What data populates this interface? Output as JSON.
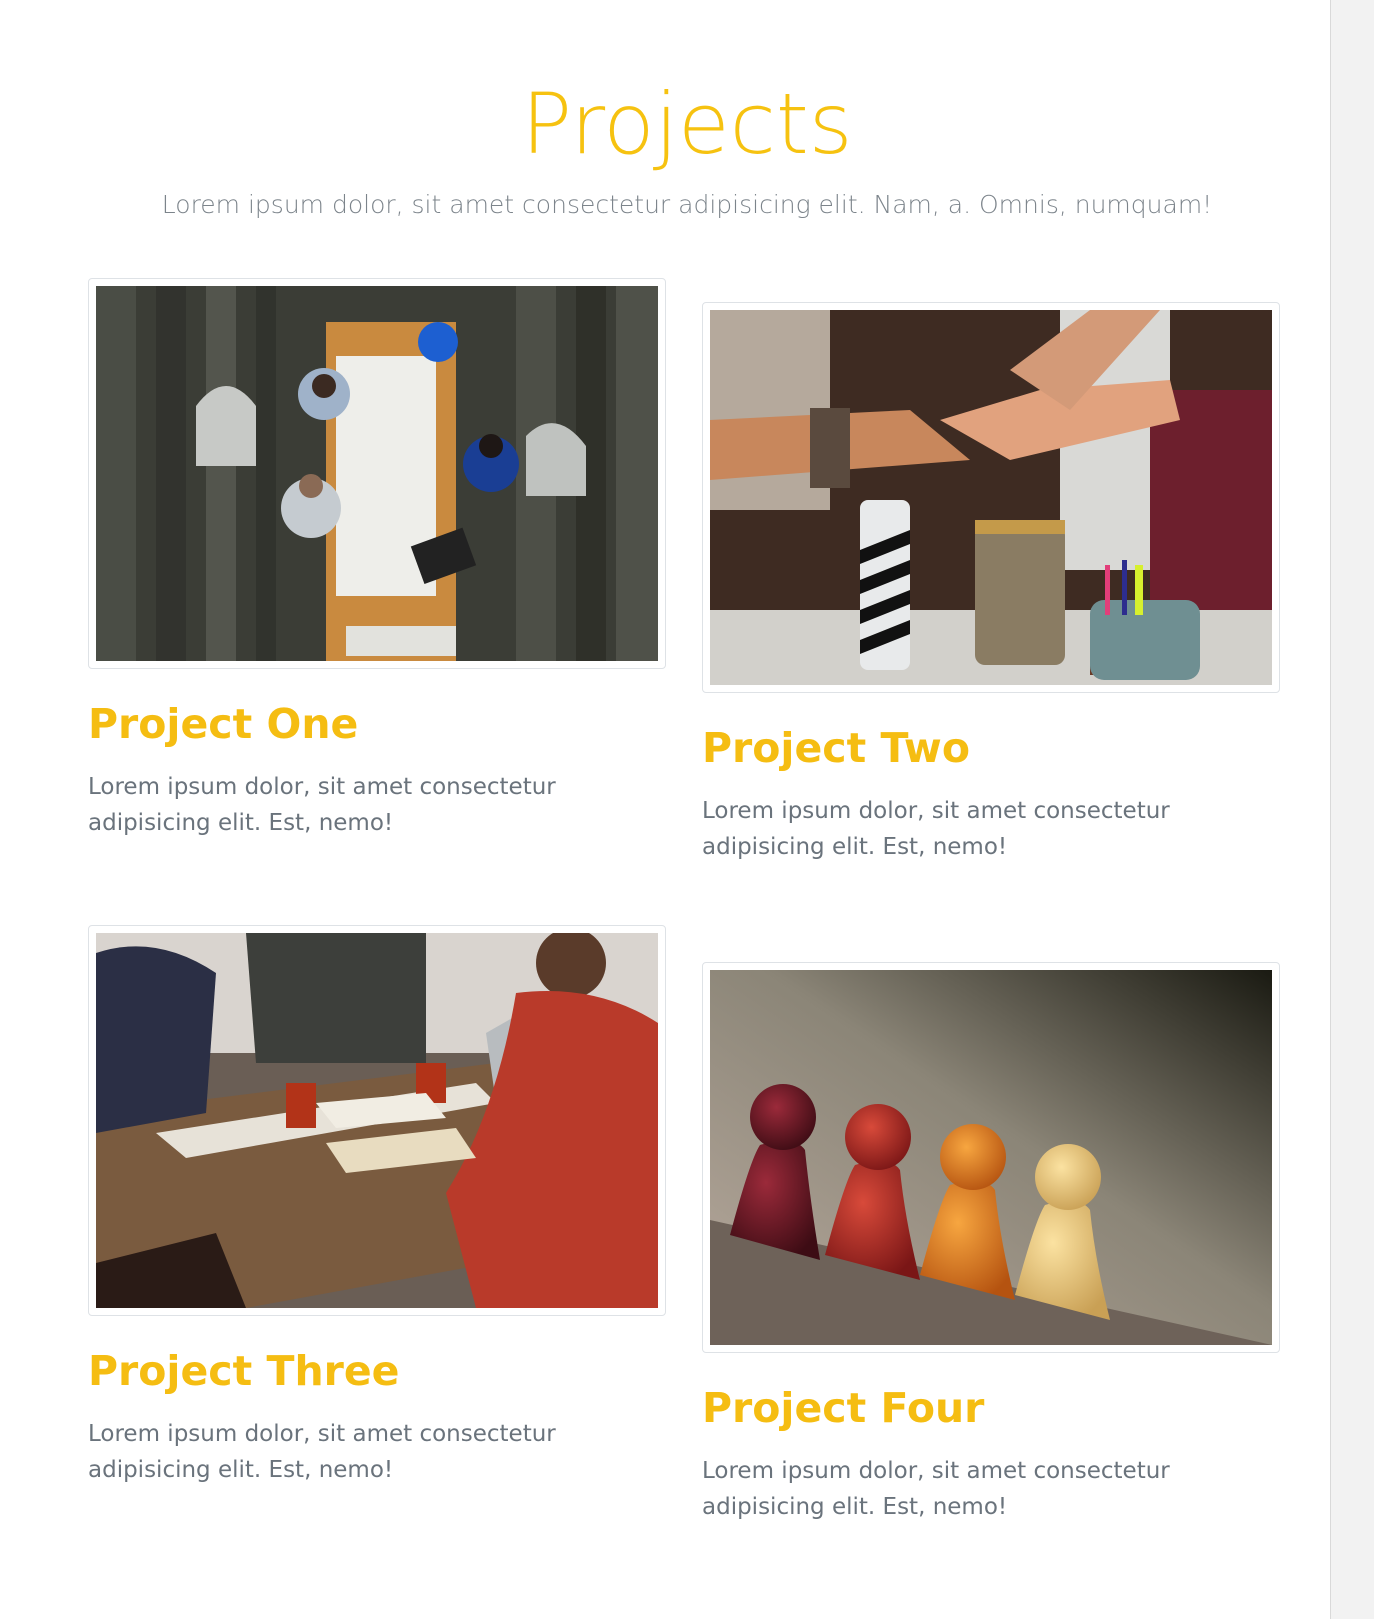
{
  "section": {
    "title": "Projects",
    "subtitle": "Lorem ipsum dolor, sit amet consectetur adipisicing elit. Nam, a. Omnis, numquam!"
  },
  "projects": [
    {
      "title": "Project One",
      "text": "Lorem ipsum dolor, sit amet consectetur adipisicing elit. Est, nemo!",
      "image": "team-office-desk-overhead-photo"
    },
    {
      "title": "Project Two",
      "text": "Lorem ipsum dolor, sit amet consectetur adipisicing elit. Est, nemo!",
      "image": "team-fist-bump-photo"
    },
    {
      "title": "Project Three",
      "text": "Lorem ipsum dolor, sit amet consectetur adipisicing elit. Est, nemo!",
      "image": "team-meeting-table-photo"
    },
    {
      "title": "Project Four",
      "text": "Lorem ipsum dolor, sit amet consectetur adipisicing elit. Est, nemo!",
      "image": "wooden-game-pieces-photo"
    }
  ],
  "colors": {
    "accent": "#f6c210",
    "muted_text": "#6a737c",
    "border": "#dee2e6"
  }
}
